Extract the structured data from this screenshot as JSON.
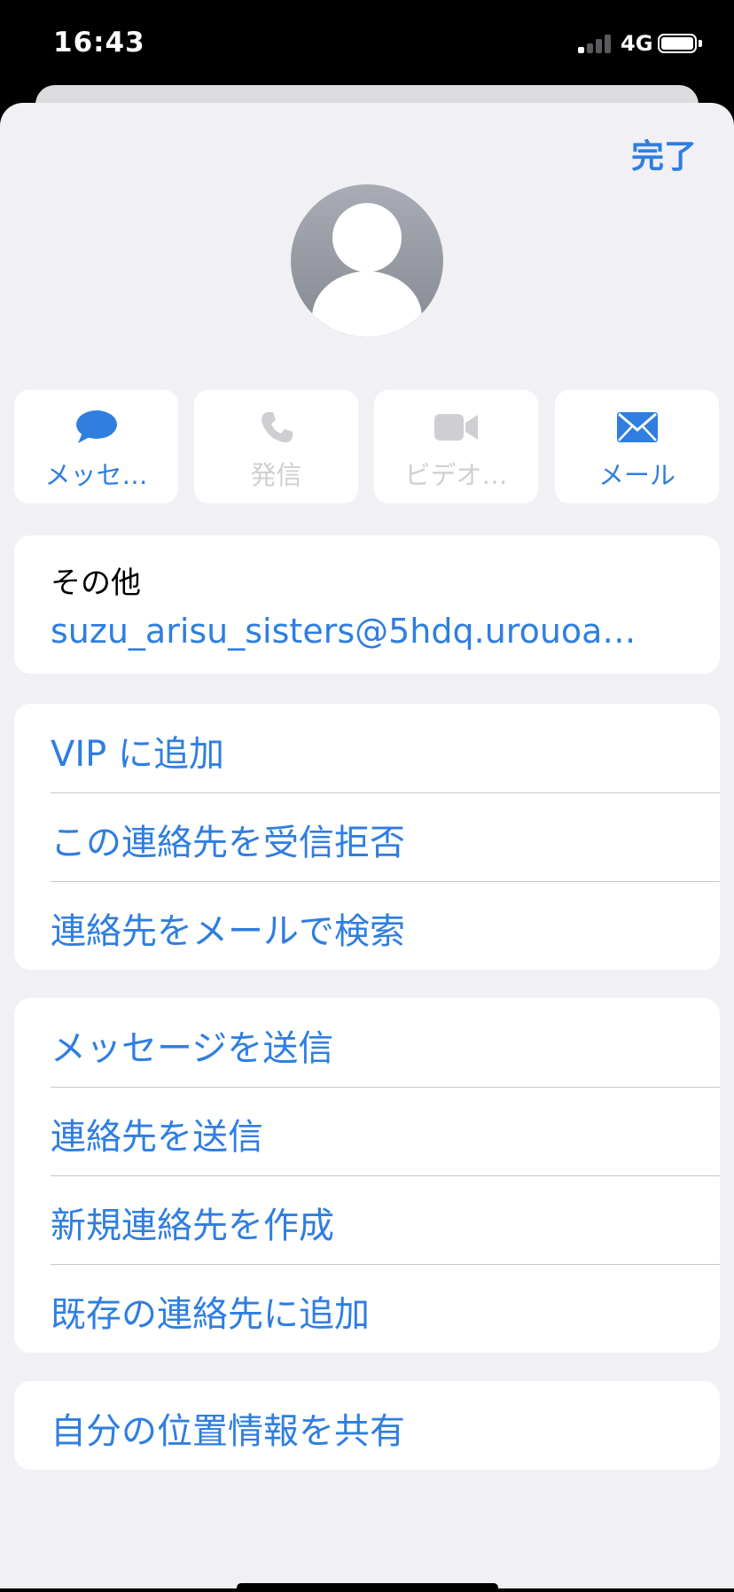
{
  "status_bar": {
    "time": "16:43",
    "network": "4G",
    "signal_bars_active": 1,
    "signal_bars_total": 4
  },
  "header": {
    "done_label": "完了"
  },
  "colors": {
    "accent": "#2f7ee0",
    "disabled": "#cfcfd3",
    "sheet_bg": "#f0f0f5"
  },
  "actions": [
    {
      "label": "メッセ…",
      "icon": "message-bubble-icon",
      "enabled": true
    },
    {
      "label": "発信",
      "icon": "phone-icon",
      "enabled": false
    },
    {
      "label": "ビデオ…",
      "icon": "video-camera-icon",
      "enabled": false
    },
    {
      "label": "メール",
      "icon": "envelope-icon",
      "enabled": true
    }
  ],
  "email": {
    "label": "その他",
    "value": "suzu_arisu_sisters@5hdq.urouoa…"
  },
  "group_a": [
    {
      "label": "VIP に追加"
    },
    {
      "label": "この連絡先を受信拒否"
    },
    {
      "label": "連絡先をメールで検索"
    }
  ],
  "group_b": [
    {
      "label": "メッセージを送信"
    },
    {
      "label": "連絡先を送信"
    },
    {
      "label": "新規連絡先を作成"
    },
    {
      "label": "既存の連絡先に追加"
    }
  ],
  "group_c": [
    {
      "label": "自分の位置情報を共有"
    }
  ]
}
